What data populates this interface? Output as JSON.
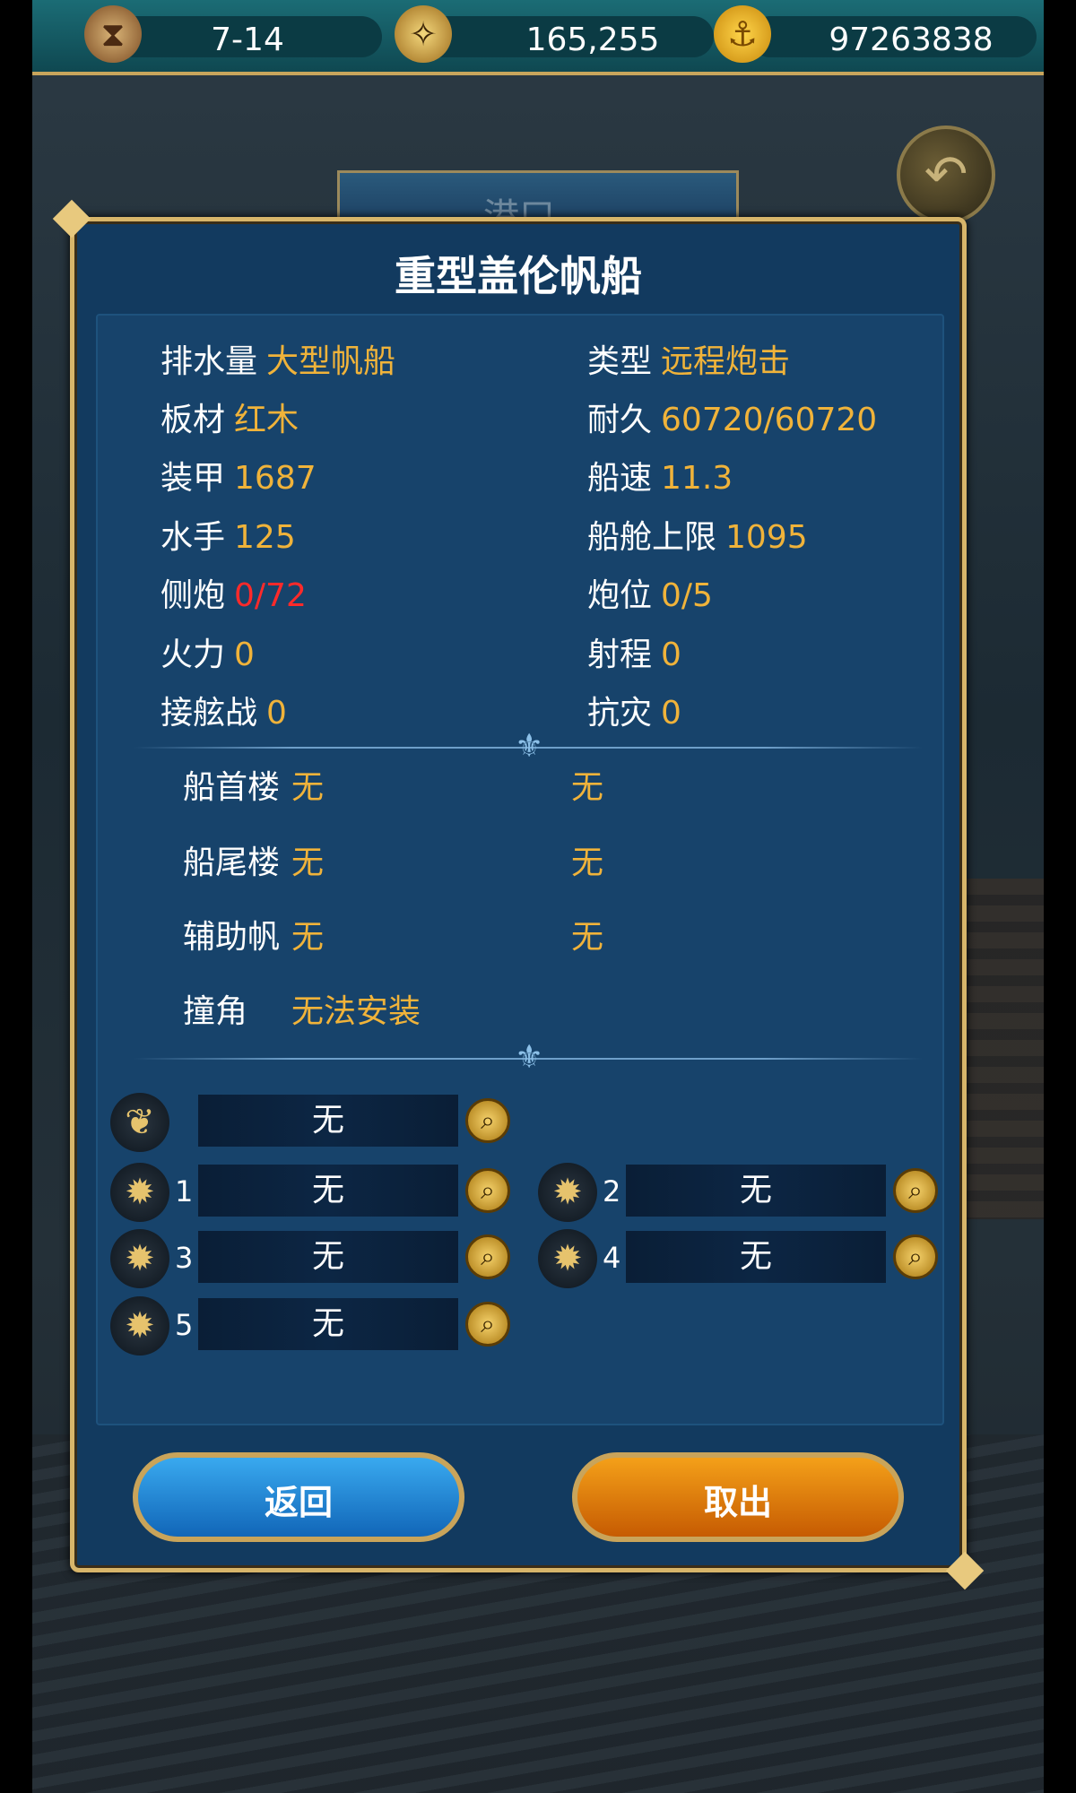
{
  "topbar": {
    "date": "7-14",
    "fame": "165,255",
    "gold": "97263838",
    "icons": [
      "hourglass-icon",
      "compass-icon",
      "gold-coin-icon"
    ]
  },
  "background": {
    "tab_label": "港口",
    "back_icon": "back-arrow-icon"
  },
  "panel": {
    "title": "重型盖伦帆船",
    "stats_left": [
      {
        "label": "排水量",
        "value": "大型帆船"
      },
      {
        "label": "板材",
        "value": "红木"
      },
      {
        "label": "装甲",
        "value": "1687"
      },
      {
        "label": "水手",
        "value": "125"
      },
      {
        "label": "侧炮",
        "value": "0/72",
        "alert": true
      },
      {
        "label": "火力",
        "value": "0"
      },
      {
        "label": "接舷战",
        "value": "0"
      }
    ],
    "stats_right": [
      {
        "label": "类型",
        "value": "远程炮击"
      },
      {
        "label": "耐久",
        "value": "60720/60720"
      },
      {
        "label": "船速",
        "value": "11.3"
      },
      {
        "label": "船舱上限",
        "value": "1095"
      },
      {
        "label": "炮位",
        "value": "0/5"
      },
      {
        "label": "射程",
        "value": "0"
      },
      {
        "label": "抗灾",
        "value": "0"
      }
    ],
    "fittings": [
      {
        "label": "船首楼",
        "value1": "无",
        "value2": "无"
      },
      {
        "label": "船尾楼",
        "value1": "无",
        "value2": "无"
      },
      {
        "label": "辅助帆",
        "value1": "无",
        "value2": "无"
      },
      {
        "label": "撞角",
        "value1": "无法安装"
      }
    ],
    "slots": {
      "sail": {
        "value": "无",
        "icon": "sail-wing-icon"
      },
      "cannons": [
        {
          "num": "1",
          "value": "无"
        },
        {
          "num": "2",
          "value": "无"
        },
        {
          "num": "3",
          "value": "无"
        },
        {
          "num": "4",
          "value": "无"
        },
        {
          "num": "5",
          "value": "无"
        }
      ]
    }
  },
  "buttons": {
    "back": "返回",
    "take_out": "取出"
  },
  "colors": {
    "value": "#f0b33a",
    "alert": "#ff2a2a",
    "panel": "#123a5f",
    "frame": "#d7b56a"
  }
}
